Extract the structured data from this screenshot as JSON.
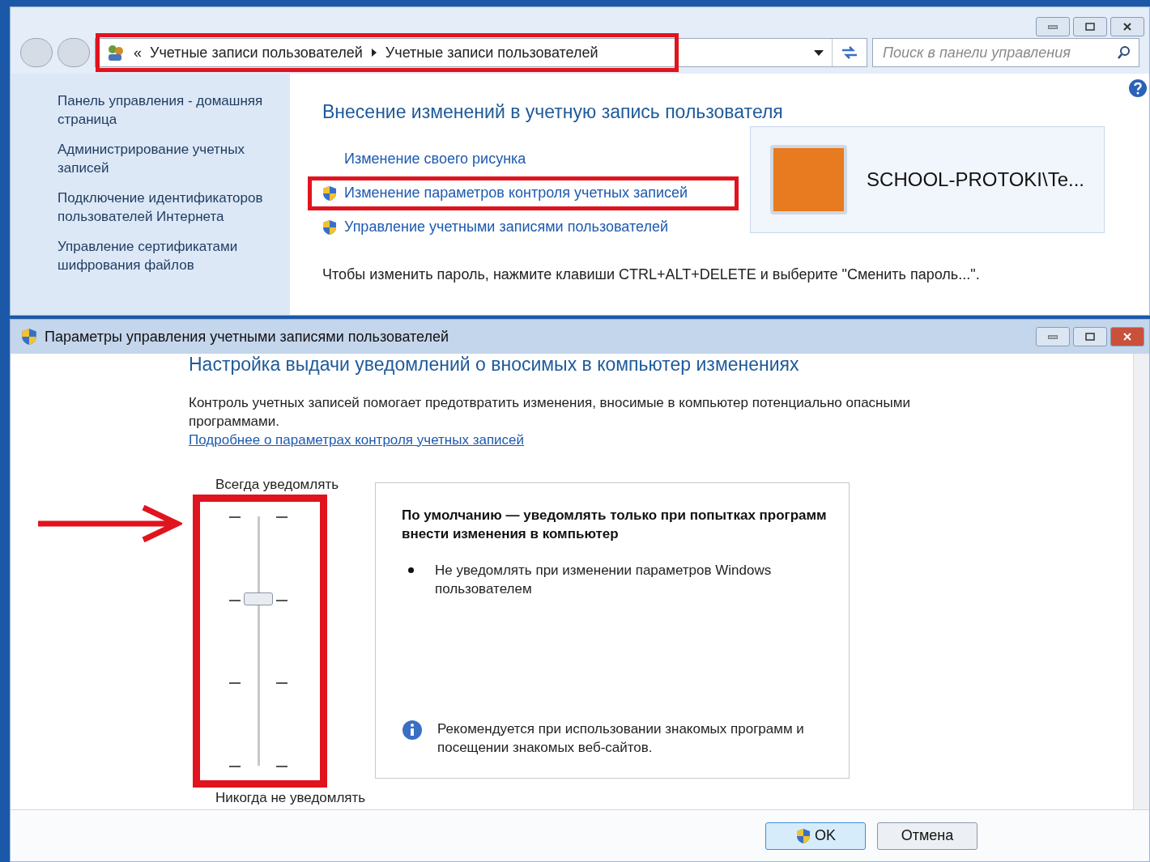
{
  "explorer": {
    "address": {
      "prefix": "«",
      "crumbs": [
        "Учетные записи пользователей",
        "Учетные записи пользователей"
      ],
      "highlighted": true
    },
    "search": {
      "placeholder": "Поиск в панели управления"
    },
    "sidebar": {
      "items": [
        "Панель управления - домашняя страница",
        "Администрирование учетных записей",
        "Подключение идентификаторов пользователей Интернета",
        "Управление сертификатами шифрования файлов"
      ]
    },
    "heading": "Внесение изменений в учетную запись пользователя",
    "tasks": [
      {
        "label": "Изменение своего рисунка",
        "kind": "plain",
        "highlighted": false
      },
      {
        "label": "Изменение параметров контроля учетных записей",
        "kind": "shield",
        "highlighted": true
      },
      {
        "label": "Управление учетными записями пользователей",
        "kind": "shield",
        "highlighted": false
      }
    ],
    "user": {
      "name": "SCHOOL-PROTOKI\\Te..."
    },
    "note": "Чтобы изменить пароль, нажмите клавиши CTRL+ALT+DELETE и выберите \"Сменить пароль...\"."
  },
  "uac": {
    "title": "Параметры управления учетными записями пользователей",
    "heading": "Настройка выдачи уведомлений о вносимых в компьютер изменениях",
    "description": "Контроль учетных записей помогает предотвратить изменения, вносимые в компьютер потенциально опасными программами.",
    "link": "Подробнее о параметрах контроля учетных записей",
    "slider": {
      "top_label": "Всегда уведомлять",
      "bottom_label": "Никогда не уведомлять",
      "level": 0.67,
      "highlighted": true
    },
    "panel": {
      "title": "По умолчанию — уведомлять только при попытках программ внести изменения в компьютер",
      "bullets": [
        "Не уведомлять при изменении параметров Windows пользователем"
      ],
      "recommendation": "Рекомендуется при использовании знакомых программ и посещении знакомых веб-сайтов."
    },
    "buttons": [
      {
        "label": "OK",
        "kind": "shield"
      },
      {
        "label": "Отмена",
        "kind": "plain"
      }
    ]
  }
}
